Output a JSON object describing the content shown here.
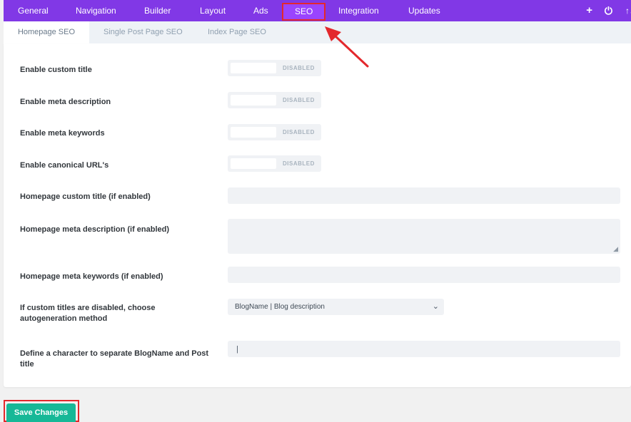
{
  "top_nav": {
    "tabs": [
      {
        "label": "General"
      },
      {
        "label": "Navigation"
      },
      {
        "label": "Builder"
      },
      {
        "label": "Layout"
      },
      {
        "label": "Ads"
      },
      {
        "label": "SEO",
        "active": true
      },
      {
        "label": "Integration"
      },
      {
        "label": "Updates"
      }
    ],
    "icons": [
      "plus-icon",
      "power-icon",
      "sort-icon"
    ],
    "icon_glyphs": [
      "+",
      "⏻",
      "↑↓"
    ],
    "background_color": "#8138e6",
    "active_tab_color": "#9a44ff"
  },
  "sub_nav": {
    "tabs": [
      {
        "label": "Homepage SEO",
        "active": true
      },
      {
        "label": "Single Post Page SEO"
      },
      {
        "label": "Index Page SEO"
      }
    ]
  },
  "settings": {
    "custom_title": {
      "label": "Enable custom title",
      "state": "DISABLED"
    },
    "meta_description": {
      "label": "Enable meta description",
      "state": "DISABLED"
    },
    "meta_keywords": {
      "label": "Enable meta keywords",
      "state": "DISABLED"
    },
    "canonical_urls": {
      "label": "Enable canonical URL's",
      "state": "DISABLED"
    },
    "homepage_custom_title": {
      "label": "Homepage custom title (if enabled)",
      "value": ""
    },
    "homepage_meta_description": {
      "label": "Homepage meta description (if enabled)",
      "value": ""
    },
    "homepage_meta_keywords": {
      "label": "Homepage meta keywords (if enabled)",
      "value": ""
    },
    "autogeneration_method": {
      "label": "If custom titles are disabled, choose autogeneration method",
      "selected": "BlogName | Blog description"
    },
    "separator": {
      "label": "Define a character to separate BlogName and Post title",
      "value": "|"
    }
  },
  "footer": {
    "save_label": "Save Changes",
    "save_color": "#17b897"
  },
  "annotation": {
    "highlight_color": "#e3282c"
  }
}
